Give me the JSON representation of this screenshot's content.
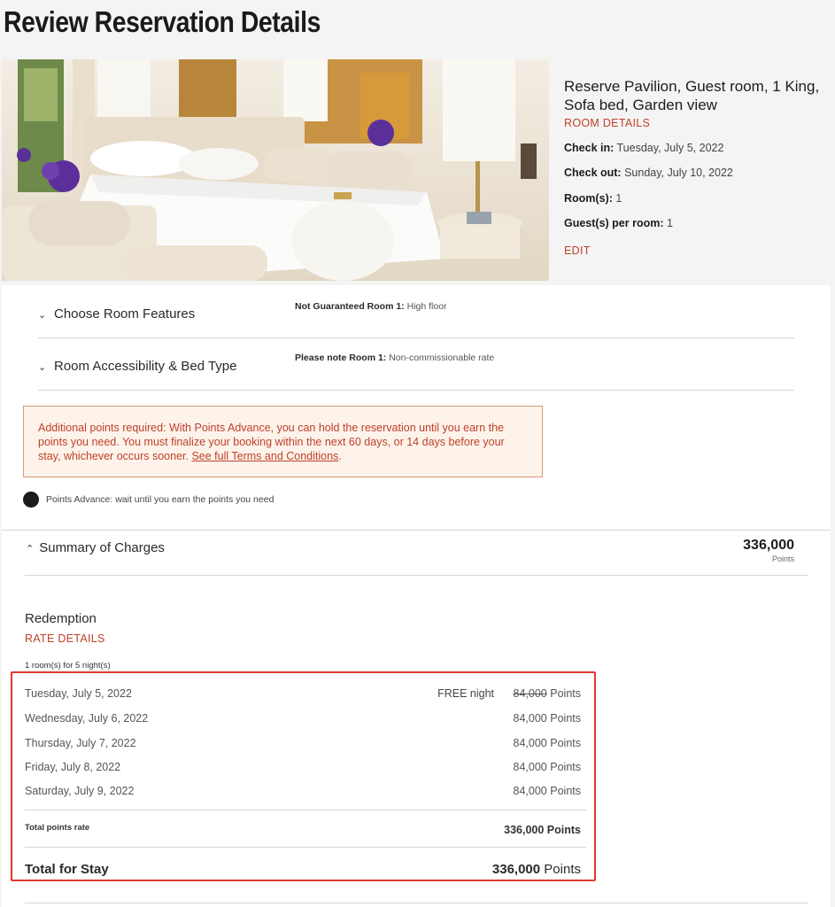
{
  "page": {
    "title": "Review Reservation Details"
  },
  "room": {
    "name": "Reserve Pavilion, Guest room, 1 King, Sofa bed, Garden view",
    "details_link": "ROOM DETAILS",
    "check_in_label": "Check in:",
    "check_in_value": "Tuesday, July 5, 2022",
    "check_out_label": "Check out:",
    "check_out_value": "Sunday, July 10, 2022",
    "rooms_label": "Room(s):",
    "rooms_value": "1",
    "guests_label": "Guest(s) per room:",
    "guests_value": "1",
    "edit_link": "EDIT"
  },
  "features": [
    {
      "label": "Choose Room Features",
      "note_label": "Not Guaranteed Room 1:",
      "note_value": "High floor"
    },
    {
      "label": "Room Accessibility & Bed Type",
      "note_label": "Please note Room 1:",
      "note_value": "Non-commissionable rate"
    }
  ],
  "alert": {
    "text": "Additional points required: With Points Advance, you can hold the reservation until you earn the points you need. You must finalize your booking within the next 60 days, or 14 days before your stay, whichever occurs sooner.",
    "link": "See full Terms and Conditions",
    "trailing": "."
  },
  "points_advance": {
    "label": "Points Advance: wait until you earn the points you need"
  },
  "summary": {
    "title": "Summary of Charges",
    "total": "336,000",
    "unit": "Points"
  },
  "redemption": {
    "title": "Redemption",
    "rate_details": "RATE DETAILS",
    "rooms_nights": "1 room(s) for 5 night(s)",
    "nights": [
      {
        "date": "Tuesday, July 5, 2022",
        "free": "FREE night",
        "points": "84,000",
        "unit": "Points"
      },
      {
        "date": "Wednesday, July 6, 2022",
        "points": "84,000",
        "unit": "Points"
      },
      {
        "date": "Thursday, July 7, 2022",
        "points": "84,000",
        "unit": "Points"
      },
      {
        "date": "Friday, July 8, 2022",
        "points": "84,000",
        "unit": "Points"
      },
      {
        "date": "Saturday, July 9, 2022",
        "points": "84,000",
        "unit": "Points"
      }
    ],
    "total_rate_label": "Total points rate",
    "total_rate_value": "336,000 Points",
    "stay_label": "Total for Stay",
    "stay_value": "336,000",
    "stay_unit": "Points"
  },
  "colors": {
    "accent": "#c0402a",
    "highlight": "#e03a2f",
    "alert_bg": "#fdf3ea"
  }
}
